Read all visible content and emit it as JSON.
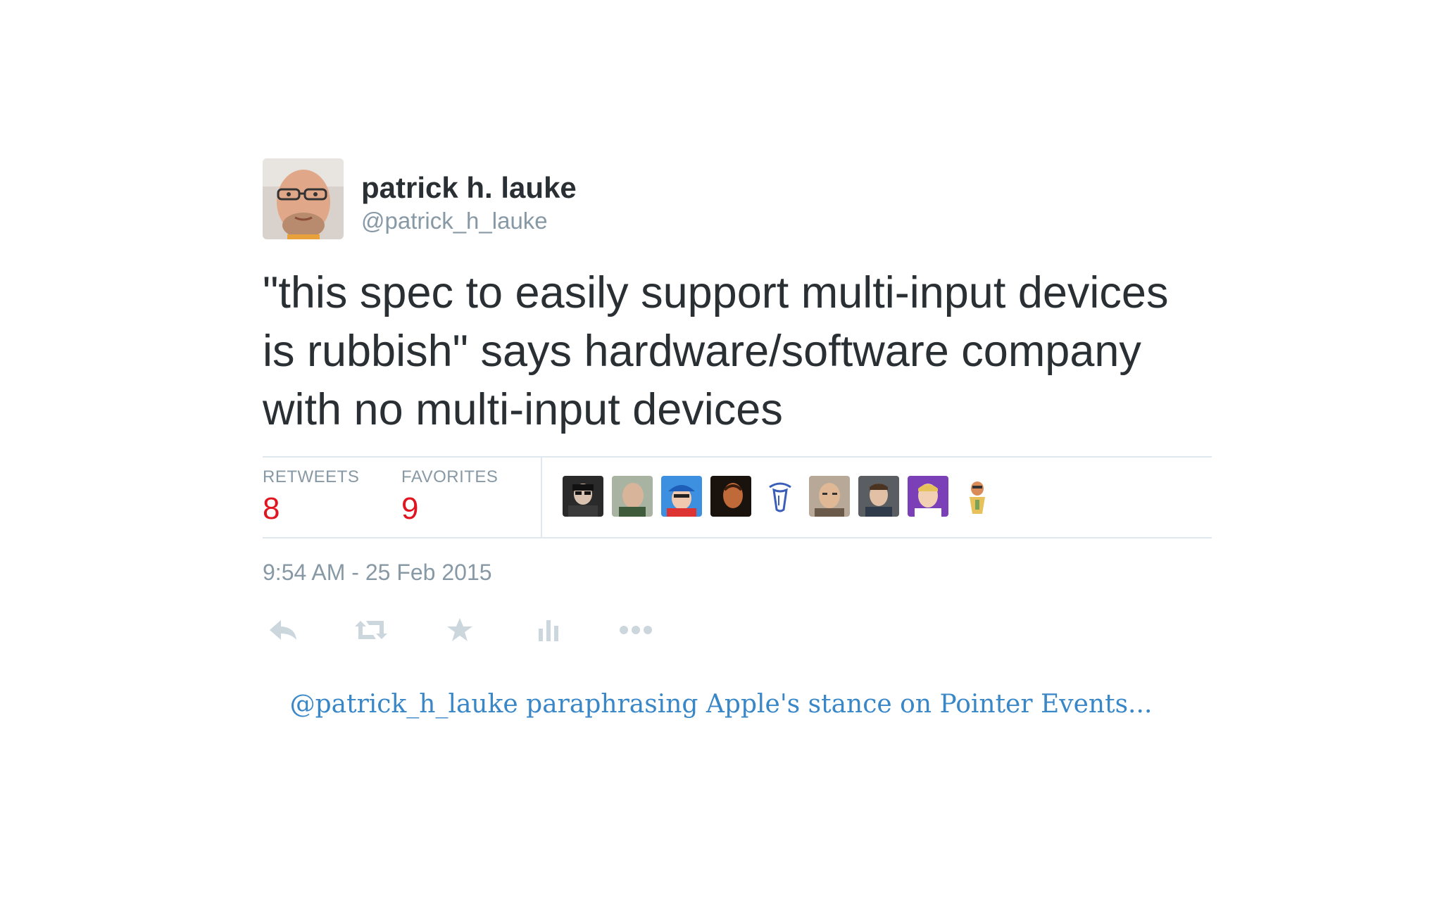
{
  "tweet": {
    "author_name": "patrick h. lauke",
    "author_handle": "@patrick_h_lauke",
    "text": "\"this spec to easily support multi-input devices is rubbish\" says hardware/software company with no multi-input devices",
    "stats": {
      "retweets_label": "RETWEETS",
      "retweets_count": "8",
      "favorites_label": "FAVORITES",
      "favorites_count": "9"
    },
    "timestamp": "9:54 AM - 25 Feb 2015",
    "actions": [
      "reply-icon",
      "retweet-icon",
      "favorite-icon",
      "stats-icon",
      "more-icon"
    ],
    "colors": {
      "text": "#292f33",
      "muted": "#8899a6",
      "count": "#e0151f",
      "icon": "#ccd6dd",
      "divider": "#e1e8ed"
    }
  },
  "caption": "@patrick_h_lauke paraphrasing Apple's stance on Pointer Events...",
  "caption_color": "#3a87c8"
}
